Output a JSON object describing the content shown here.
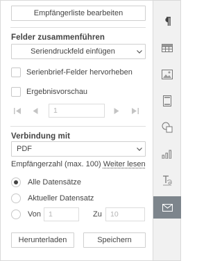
{
  "top_button": "Empfängerliste bearbeiten",
  "merge_fields": {
    "title": "Felder zusammenführen",
    "select_value": "Seriendruckfeld einfügen",
    "highlight_label": "Serienbrief-Felder hervorheben",
    "preview_label": "Ergebnisvorschau",
    "record_value": "1"
  },
  "connect": {
    "title": "Verbindung mit",
    "select_value": "PDF",
    "count_label": "Empfängerzahl (max. 100)",
    "read_more": "Weiter lesen"
  },
  "records": {
    "all_label": "Alle Datensätze",
    "current_label": "Aktueller Datensatz",
    "from_label": "Von",
    "from_value": "1",
    "to_label": "Zu",
    "to_value": "10",
    "selected": "all"
  },
  "actions": {
    "download": "Herunterladen",
    "save": "Speichern"
  },
  "sidebar_icons": [
    "paragraph-icon",
    "table-icon",
    "image-icon",
    "header-footer-icon",
    "shape-icon",
    "chart-icon",
    "text-art-icon",
    "mail-merge-icon"
  ],
  "colors": {
    "sidebar_active": "#7d858c",
    "sidebar_bg": "#f1f1f1"
  }
}
